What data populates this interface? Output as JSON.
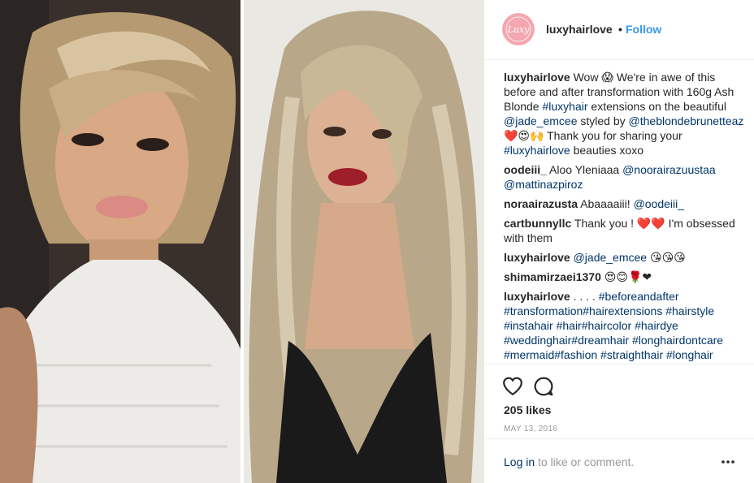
{
  "post": {
    "author": "luxyhairlove",
    "follow_label": "Follow",
    "separator": "•",
    "avatar_text": "Luxy",
    "caption": {
      "username": "luxyhairlove",
      "text_1": "Wow 😱 We're in awe of this before and after transformation with 160g Ash Blonde ",
      "tag_luxyhair": "#luxyhair",
      "text_2": " extensions on the beautiful ",
      "mention_jade": "@jade_emcee",
      "text_3": " styled by ",
      "mention_brunette": "@theblondebrunetteaz",
      "text_4": " ❤️😍🙌 Thank you for sharing your ",
      "tag_luxyhairlove": "#luxyhairlove",
      "text_5": " beauties xoxo"
    },
    "comments": [
      {
        "username": "oodeiii_",
        "pre": "Aloo Yleniaaa ",
        "mention": "@noorairazuustaa @mattinazpiroz",
        "post": ""
      },
      {
        "username": "noraairazusta",
        "pre": "Abaaaaiii! ",
        "mention": "@oodeiii_",
        "post": ""
      },
      {
        "username": "cartbunnyllc",
        "pre": "Thank you ! ❤️❤️ I'm obsessed with them",
        "mention": "",
        "post": ""
      },
      {
        "username": "luxyhairlove",
        "pre": "",
        "mention": "@jade_emcee",
        "post": " 😘😘😘"
      },
      {
        "username": "shimamirzaei1370",
        "pre": "😍😊🌹❤",
        "mention": "",
        "post": ""
      },
      {
        "username": "luxyhairlove",
        "pre": ". . . . ",
        "mention": "#beforeandafter #transformation#hairextensions #hairstyle #instahair #hair#haircolor #hairdye #weddinghair#dreamhair #longhairdontcare #mermaid#fashion #straighthair #longhair",
        "post": ""
      }
    ],
    "likes": "205 likes",
    "date": "MAY 13, 2016",
    "login_link": "Log in",
    "login_rest": " to like or comment."
  },
  "icons": [
    "heart-icon",
    "comment-icon",
    "more-options-icon"
  ],
  "colors": {
    "link": "#3897f0",
    "mention": "#003569",
    "muted": "#999999",
    "avatar": "#f4a7b0"
  }
}
